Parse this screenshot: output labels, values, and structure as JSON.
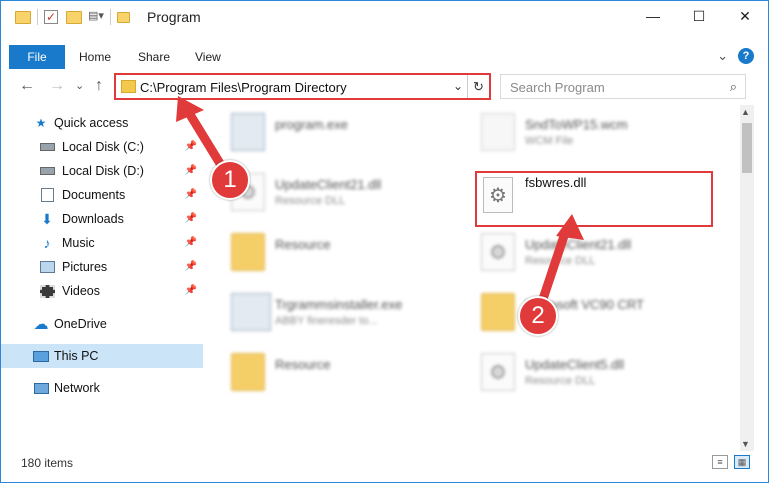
{
  "window": {
    "title": "Program"
  },
  "window_controls": {
    "minimize": "—",
    "maximize": "☐",
    "close": "✕"
  },
  "ribbon": {
    "file": "File",
    "tabs": [
      "Home",
      "Share",
      "View"
    ],
    "expand": "⌄",
    "help": "?"
  },
  "nav": {
    "back": "←",
    "forward": "→",
    "recent": "⌄",
    "up": "↑"
  },
  "address": {
    "path": "C:\\Program Files\\Program Directory",
    "dropdown": "⌄",
    "refresh": "↻"
  },
  "search": {
    "placeholder": "Search Program",
    "icon": "⌕"
  },
  "sidebar": {
    "items": [
      {
        "label": "Quick access",
        "icon": "star-icon"
      },
      {
        "label": "Local Disk (C:)",
        "icon": "drive-icon",
        "pinned": true
      },
      {
        "label": "Local Disk (D:)",
        "icon": "drive-icon",
        "pinned": true
      },
      {
        "label": "Documents",
        "icon": "documents-icon",
        "pinned": true
      },
      {
        "label": "Downloads",
        "icon": "download-icon",
        "pinned": true
      },
      {
        "label": "Music",
        "icon": "music-icon",
        "pinned": true
      },
      {
        "label": "Pictures",
        "icon": "pictures-icon",
        "pinned": true
      },
      {
        "label": "Videos",
        "icon": "videos-icon",
        "pinned": true
      },
      {
        "label": "OneDrive",
        "icon": "cloud-icon"
      },
      {
        "label": "This PC",
        "icon": "computer-icon",
        "selected": true
      },
      {
        "label": "Network",
        "icon": "network-icon"
      }
    ]
  },
  "files": [
    {
      "name": "program.exe",
      "type": ""
    },
    {
      "name": "SndToWP15.wcm",
      "type": "WCM File"
    },
    {
      "name": "UpdateClient21.dll",
      "type": "Resource DLL"
    },
    {
      "name": "fsbwres.dll",
      "type": ""
    },
    {
      "name": "Resource",
      "type": ""
    },
    {
      "name": "UpdateClient21.dll",
      "type": "Resource DLL"
    },
    {
      "name": "Trgrammsinstaller.exe",
      "type": "ABBY fineresder to..."
    },
    {
      "name": "Microsoft VC90 CRT",
      "type": ""
    },
    {
      "name": "Resource",
      "type": ""
    },
    {
      "name": "UpdateClient5.dll",
      "type": "Resource DLL"
    }
  ],
  "status": {
    "items": "180 items"
  },
  "annotations": {
    "step1": "1",
    "step2": "2"
  },
  "colors": {
    "accent": "#1979ca",
    "highlight": "#e03a3a",
    "selected": "#cce4f7"
  }
}
